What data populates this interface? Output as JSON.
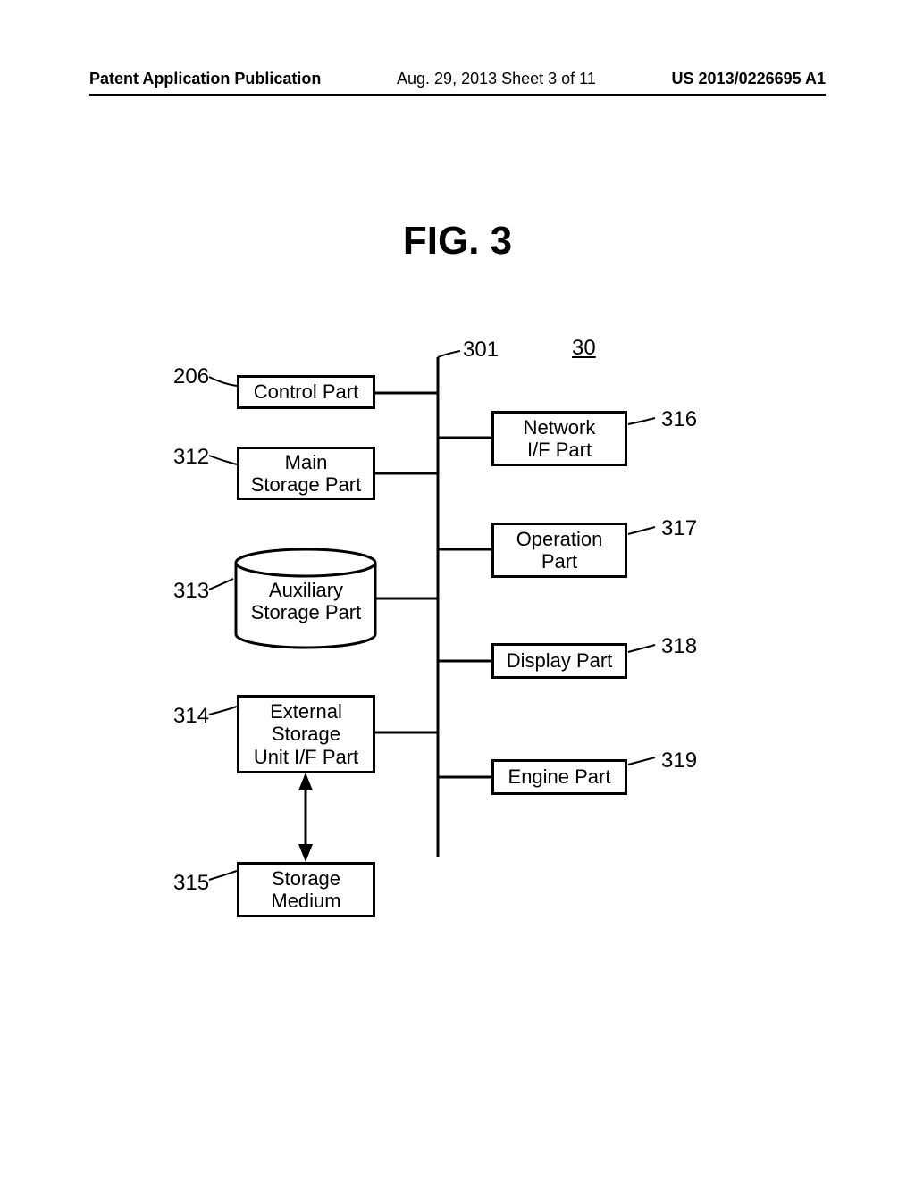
{
  "header": {
    "left": "Patent Application Publication",
    "center": "Aug. 29, 2013  Sheet 3 of 11",
    "right": "US 2013/0226695 A1"
  },
  "figure": {
    "title": "FIG. 3"
  },
  "system_ref": "30",
  "bus_ref": "301",
  "blocks": {
    "control": {
      "ref": "206",
      "label": "Control Part"
    },
    "main_storage": {
      "ref": "312",
      "label": "Main\nStorage Part"
    },
    "aux_storage": {
      "ref": "313",
      "label": "Auxiliary\nStorage Part"
    },
    "ext_storage_if": {
      "ref": "314",
      "label": "External\nStorage\nUnit I/F Part"
    },
    "storage_medium": {
      "ref": "315",
      "label": "Storage\nMedium"
    },
    "network_if": {
      "ref": "316",
      "label": "Network\nI/F Part"
    },
    "operation": {
      "ref": "317",
      "label": "Operation\nPart"
    },
    "display": {
      "ref": "318",
      "label": "Display Part"
    },
    "engine": {
      "ref": "319",
      "label": "Engine Part"
    }
  }
}
